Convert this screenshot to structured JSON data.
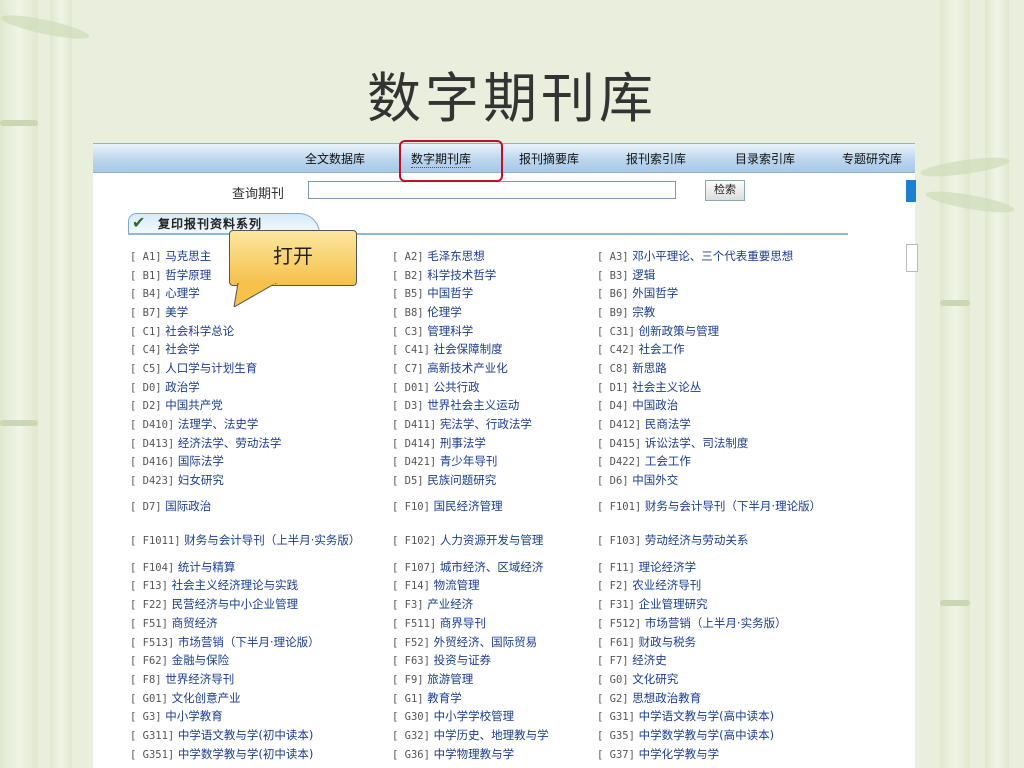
{
  "slide": {
    "title": "数字期刊库"
  },
  "nav": [
    {
      "label": "全文数据库"
    },
    {
      "label": "数字期刊库"
    },
    {
      "label": "报刊摘要库"
    },
    {
      "label": "报刊索引库"
    },
    {
      "label": "目录索引库"
    },
    {
      "label": "专题研究库"
    }
  ],
  "search": {
    "label": "查询期刊",
    "value": "",
    "button": "检索"
  },
  "section": {
    "title": "复印报刊资料系列"
  },
  "callout": {
    "text": "打开"
  },
  "colors": {
    "highlight": "#c0102a",
    "link": "#1a3d8c",
    "callout": "#f6c04a"
  },
  "rows": [
    [
      {
        "code": "[ A1]",
        "name": "马克思主"
      },
      {
        "code": "[ A2]",
        "name": "毛泽东思想"
      },
      {
        "code": "[ A3]",
        "name": "邓小平理论、三个代表重要思想"
      }
    ],
    [
      {
        "code": "[ B1]",
        "name": "哲学原理"
      },
      {
        "code": "[ B2]",
        "name": "科学技术哲学"
      },
      {
        "code": "[ B3]",
        "name": "逻辑"
      }
    ],
    [
      {
        "code": "[ B4]",
        "name": "心理学"
      },
      {
        "code": "[ B5]",
        "name": "中国哲学"
      },
      {
        "code": "[ B6]",
        "name": "外国哲学"
      }
    ],
    [
      {
        "code": "[ B7]",
        "name": "美学"
      },
      {
        "code": "[ B8]",
        "name": "伦理学"
      },
      {
        "code": "[ B9]",
        "name": "宗教"
      }
    ],
    [
      {
        "code": "[ C1]",
        "name": "社会科学总论"
      },
      {
        "code": "[ C3]",
        "name": "管理科学"
      },
      {
        "code": "[ C31]",
        "name": "创新政策与管理"
      }
    ],
    [
      {
        "code": "[ C4]",
        "name": "社会学"
      },
      {
        "code": "[ C41]",
        "name": "社会保障制度"
      },
      {
        "code": "[ C42]",
        "name": "社会工作"
      }
    ],
    [
      {
        "code": "[ C5]",
        "name": "人口学与计划生育"
      },
      {
        "code": "[ C7]",
        "name": "高新技术产业化"
      },
      {
        "code": "[ C8]",
        "name": "新思路"
      }
    ],
    [
      {
        "code": "[ D0]",
        "name": "政治学"
      },
      {
        "code": "[ D01]",
        "name": "公共行政"
      },
      {
        "code": "[ D1]",
        "name": "社会主义论丛"
      }
    ],
    [
      {
        "code": "[ D2]",
        "name": "中国共产党"
      },
      {
        "code": "[ D3]",
        "name": "世界社会主义运动"
      },
      {
        "code": "[ D4]",
        "name": "中国政治"
      }
    ],
    [
      {
        "code": "[ D410]",
        "name": "法理学、法史学"
      },
      {
        "code": "[ D411]",
        "name": "宪法学、行政法学"
      },
      {
        "code": "[ D412]",
        "name": "民商法学"
      }
    ],
    [
      {
        "code": "[ D413]",
        "name": "经济法学、劳动法学"
      },
      {
        "code": "[ D414]",
        "name": "刑事法学"
      },
      {
        "code": "[ D415]",
        "name": "诉讼法学、司法制度"
      }
    ],
    [
      {
        "code": "[ D416]",
        "name": "国际法学"
      },
      {
        "code": "[ D421]",
        "name": "青少年导刊"
      },
      {
        "code": "[ D422]",
        "name": "工会工作"
      }
    ],
    [
      {
        "code": "[ D423]",
        "name": "妇女研究"
      },
      {
        "code": "[ D5]",
        "name": "民族问题研究"
      },
      {
        "code": "[ D6]",
        "name": "中国外交"
      }
    ],
    [
      {
        "code": "[ D7]",
        "name": "国际政治"
      },
      {
        "code": "[ F10]",
        "name": "国民经济管理"
      },
      {
        "code": "[ F101]",
        "name": "财务与会计导刊（下半月·理论版）"
      }
    ],
    [
      {
        "code": "[ F1011]",
        "name": "财务与会计导刊（上半月·实务版）"
      },
      {
        "code": "[ F102]",
        "name": "人力资源开发与管理"
      },
      {
        "code": "[ F103]",
        "name": "劳动经济与劳动关系"
      }
    ],
    [
      {
        "code": "[ F104]",
        "name": "统计与精算"
      },
      {
        "code": "[ F107]",
        "name": "城市经济、区域经济"
      },
      {
        "code": "[ F11]",
        "name": "理论经济学"
      }
    ],
    [
      {
        "code": "[ F13]",
        "name": "社会主义经济理论与实践"
      },
      {
        "code": "[ F14]",
        "name": "物流管理"
      },
      {
        "code": "[ F2]",
        "name": "农业经济导刊"
      }
    ],
    [
      {
        "code": "[ F22]",
        "name": "民营经济与中小企业管理"
      },
      {
        "code": "[ F3]",
        "name": "产业经济"
      },
      {
        "code": "[ F31]",
        "name": "企业管理研究"
      }
    ],
    [
      {
        "code": "[ F51]",
        "name": "商贸经济"
      },
      {
        "code": "[ F511]",
        "name": "商界导刊"
      },
      {
        "code": "[ F512]",
        "name": "市场营销（上半月·实务版）"
      }
    ],
    [
      {
        "code": "[ F513]",
        "name": "市场营销（下半月·理论版）"
      },
      {
        "code": "[ F52]",
        "name": "外贸经济、国际贸易"
      },
      {
        "code": "[ F61]",
        "name": "财政与税务"
      }
    ],
    [
      {
        "code": "[ F62]",
        "name": "金融与保险"
      },
      {
        "code": "[ F63]",
        "name": "投资与证券"
      },
      {
        "code": "[ F7]",
        "name": "经济史"
      }
    ],
    [
      {
        "code": "[ F8]",
        "name": "世界经济导刊"
      },
      {
        "code": "[ F9]",
        "name": "旅游管理"
      },
      {
        "code": "[ G0]",
        "name": "文化研究"
      }
    ],
    [
      {
        "code": "[ G01]",
        "name": "文化创意产业"
      },
      {
        "code": "[ G1]",
        "name": "教育学"
      },
      {
        "code": "[ G2]",
        "name": "思想政治教育"
      }
    ],
    [
      {
        "code": "[ G3]",
        "name": "中小学教育"
      },
      {
        "code": "[ G30]",
        "name": "中小学学校管理"
      },
      {
        "code": "[ G31]",
        "name": "中学语文教与学(高中读本)"
      }
    ],
    [
      {
        "code": "[ G311]",
        "name": "中学语文教与学(初中读本)"
      },
      {
        "code": "[ G32]",
        "name": "中学历史、地理教与学"
      },
      {
        "code": "[ G35]",
        "name": "中学数学教与学(高中读本)"
      }
    ],
    [
      {
        "code": "[ G351]",
        "name": "中学数学教与学(初中读本)"
      },
      {
        "code": "[ G36]",
        "name": "中学物理教与学"
      },
      {
        "code": "[ G37]",
        "name": "中学化学教与学"
      }
    ]
  ]
}
